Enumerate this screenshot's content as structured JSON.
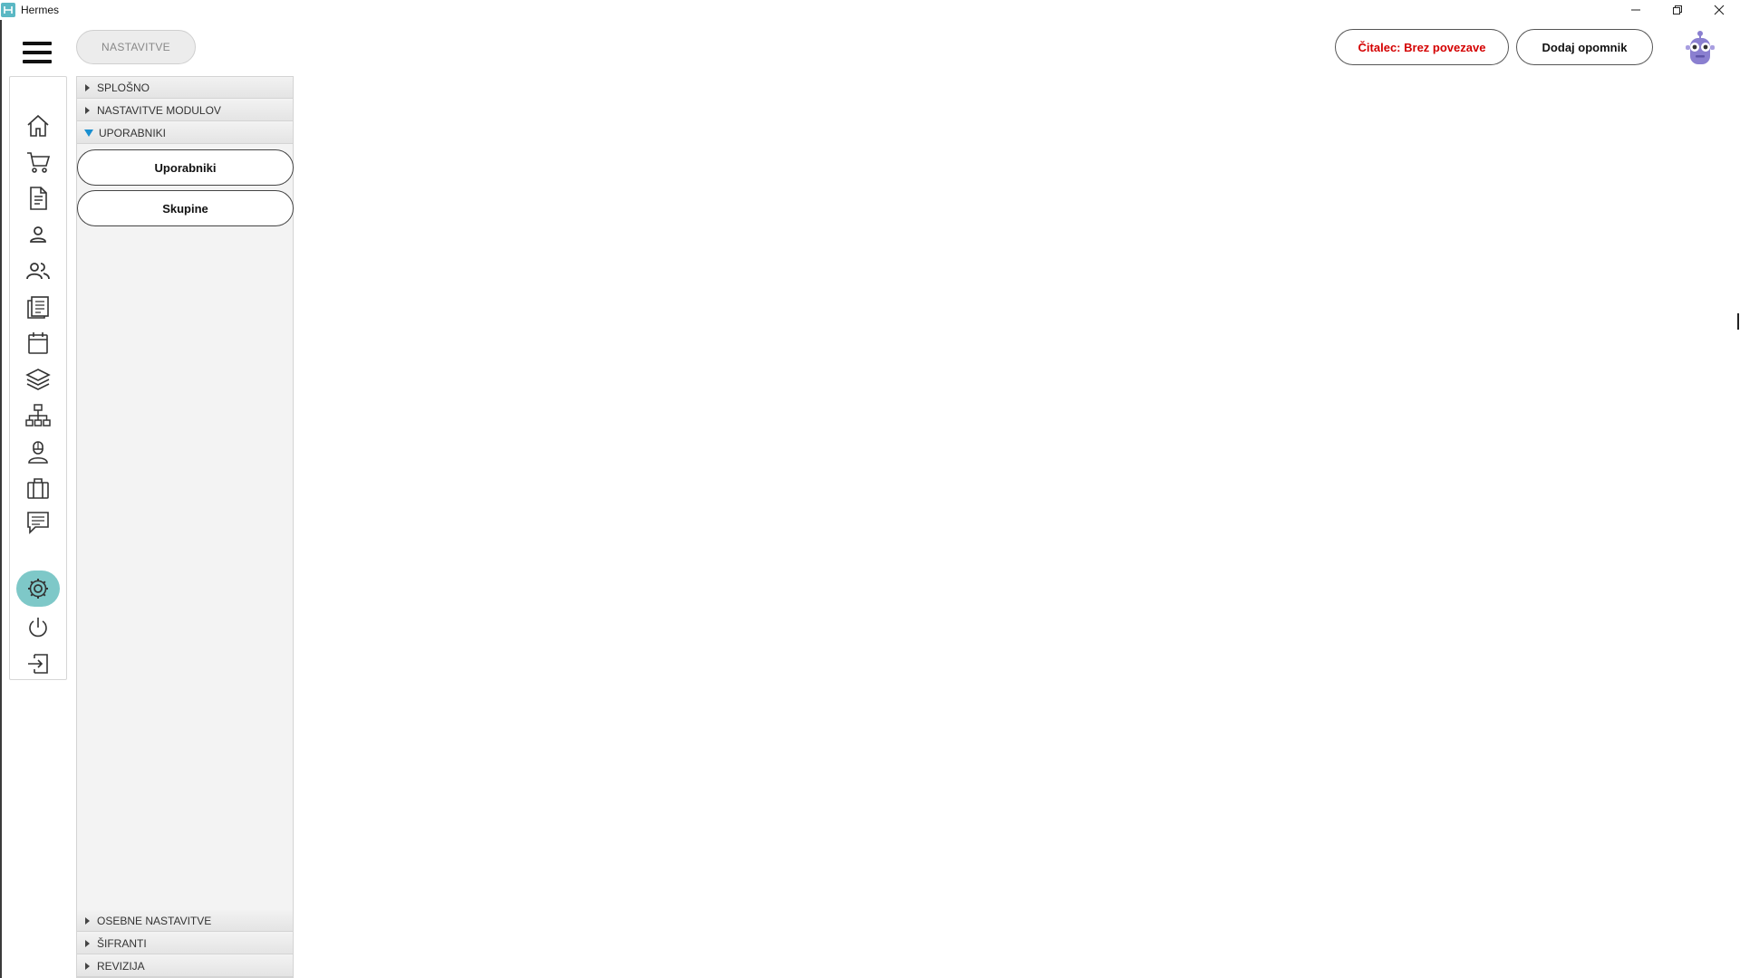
{
  "window": {
    "title": "Hermes",
    "controls": [
      "minimize-icon",
      "restore-icon",
      "close-icon"
    ]
  },
  "header": {
    "page_tab": "NASTAVITVE",
    "reader_status": "Čitalec: Brez povezave",
    "add_reminder": "Dodaj opomnik"
  },
  "colors": {
    "accent": "#7ec8c8",
    "reader_status": "#d40000",
    "expand_arrow": "#1a8fd0",
    "avatar": "#8a7fd0"
  },
  "rail": {
    "items": [
      "home-icon",
      "cart-icon",
      "document-icon",
      "person-icon",
      "people-icon",
      "newspaper-icon",
      "calendar-icon",
      "layers-icon",
      "network-icon",
      "user-badge-icon",
      "briefcase-icon",
      "chat-icon",
      "settings-icon",
      "power-icon",
      "logout-icon"
    ],
    "active": "settings-icon"
  },
  "settings_panel": {
    "sections_top": [
      {
        "label": "SPLOŠNO",
        "expanded": false
      },
      {
        "label": "NASTAVITVE MODULOV",
        "expanded": false
      },
      {
        "label": "UPORABNIKI",
        "expanded": true
      }
    ],
    "sub_items": [
      "Uporabniki",
      "Skupine"
    ],
    "sections_bottom": [
      {
        "label": "OSEBNE NASTAVITVE",
        "expanded": false
      },
      {
        "label": "ŠIFRANTI",
        "expanded": false
      },
      {
        "label": "REVIZIJA",
        "expanded": false
      }
    ]
  }
}
